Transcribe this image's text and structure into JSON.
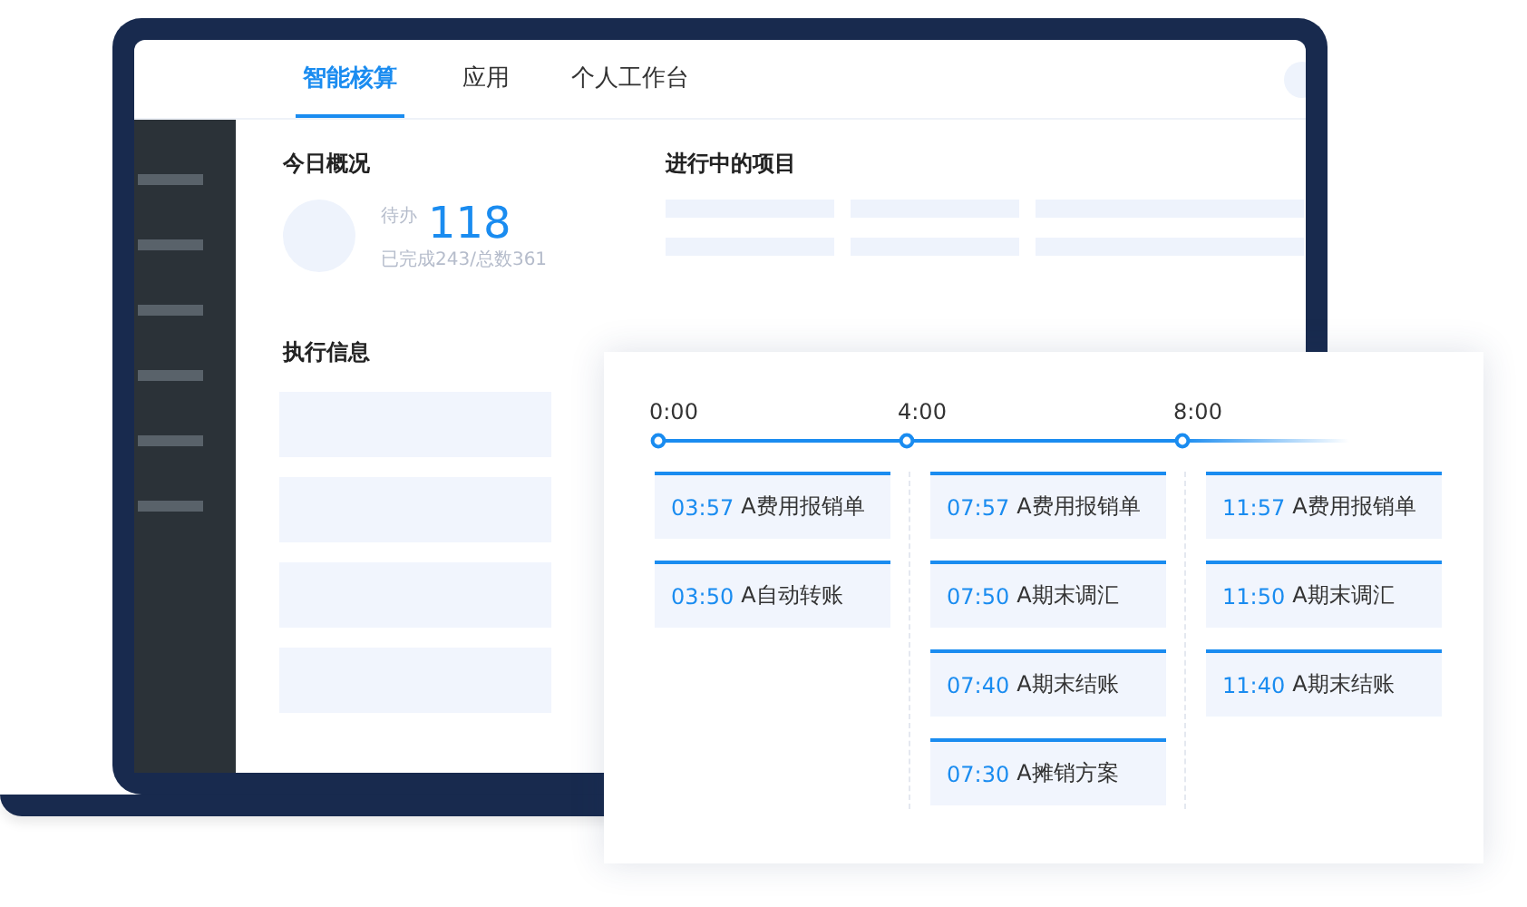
{
  "tabs": [
    {
      "label": "智能核算",
      "selected": true
    },
    {
      "label": "应用",
      "selected": false
    },
    {
      "label": "个人工作台",
      "selected": false
    }
  ],
  "overview": {
    "title": "今日概况",
    "pending_label": "待办",
    "pending_count": "118",
    "summary": "已完成243/总数361"
  },
  "projects": {
    "title": "进行中的项目"
  },
  "execution": {
    "title": "执行信息"
  },
  "timeline": {
    "ticks": [
      "0:00",
      "4:00",
      "8:00"
    ],
    "columns": [
      {
        "entries": [
          {
            "time": "03:57",
            "name": "A费用报销单"
          },
          {
            "time": "03:50",
            "name": "A自动转账"
          }
        ]
      },
      {
        "entries": [
          {
            "time": "07:57",
            "name": "A费用报销单"
          },
          {
            "time": "07:50",
            "name": "A期末调汇"
          },
          {
            "time": "07:40",
            "name": "A期末结账"
          },
          {
            "time": "07:30",
            "name": "A摊销方案"
          }
        ]
      },
      {
        "entries": [
          {
            "time": "11:57",
            "name": "A费用报销单"
          },
          {
            "time": "11:50",
            "name": "A期末调汇"
          },
          {
            "time": "11:40",
            "name": "A期末结账"
          }
        ]
      }
    ]
  }
}
